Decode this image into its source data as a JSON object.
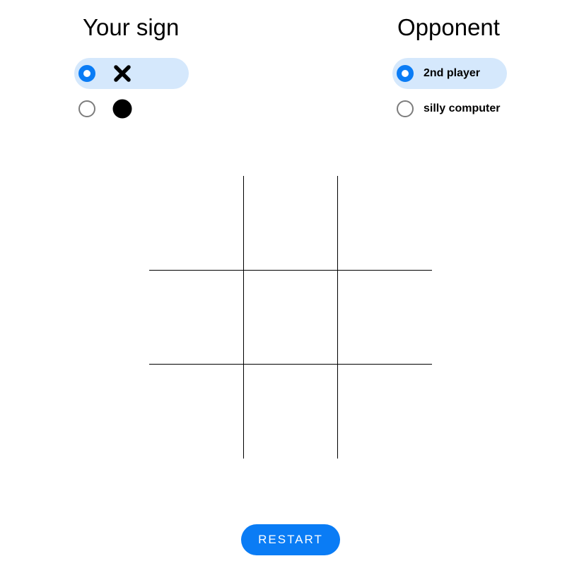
{
  "sign_section": {
    "title": "Your sign",
    "options": [
      {
        "value": "x",
        "icon": "x-mark-icon",
        "selected": true
      },
      {
        "value": "o",
        "icon": "filled-circle-icon",
        "selected": false
      }
    ]
  },
  "opponent_section": {
    "title": "Opponent",
    "options": [
      {
        "label": "2nd player",
        "selected": true
      },
      {
        "label": "silly computer",
        "selected": false
      }
    ]
  },
  "board": {
    "rows": 3,
    "cols": 3,
    "cells": [
      "",
      "",
      "",
      "",
      "",
      "",
      "",
      "",
      ""
    ]
  },
  "restart_label": "RESTART",
  "colors": {
    "accent": "#0a7cf5",
    "selected_bg": "#d5e8fc",
    "grid_line": "#000000",
    "radio_off": "#7c7c7c"
  }
}
